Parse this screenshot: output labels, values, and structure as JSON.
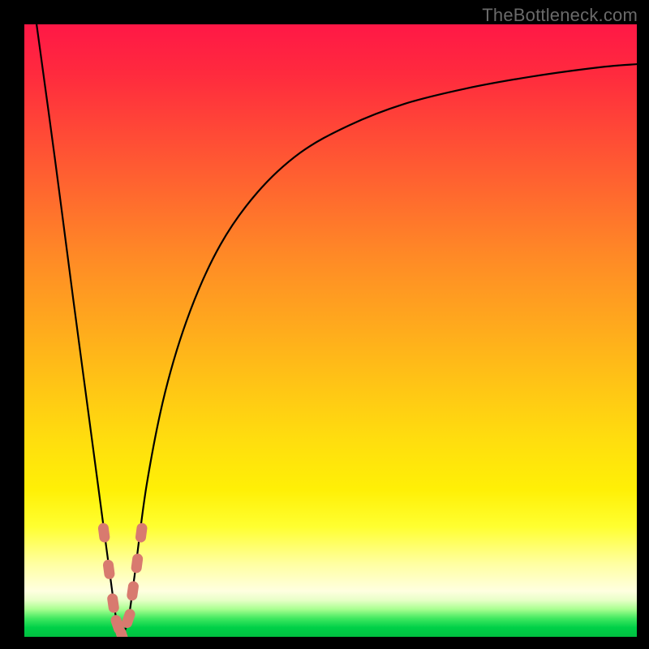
{
  "watermark": "TheBottleneck.com",
  "chart_data": {
    "type": "line",
    "title": "",
    "xlabel": "",
    "ylabel": "",
    "xlim": [
      0,
      1
    ],
    "ylim": [
      0,
      100
    ],
    "series": [
      {
        "name": "bottleneck-curve",
        "x": [
          0.02,
          0.05,
          0.08,
          0.1,
          0.12,
          0.14,
          0.15,
          0.16,
          0.17,
          0.18,
          0.2,
          0.23,
          0.27,
          0.32,
          0.38,
          0.45,
          0.53,
          0.62,
          0.72,
          0.83,
          0.94,
          1.0
        ],
        "y": [
          100.0,
          78.0,
          55.0,
          40.0,
          25.0,
          10.0,
          3.0,
          0.0,
          3.0,
          10.0,
          25.0,
          40.0,
          53.0,
          64.0,
          72.5,
          79.0,
          83.5,
          87.0,
          89.5,
          91.5,
          93.0,
          93.5
        ]
      }
    ],
    "markers": {
      "name": "highlight-points",
      "color": "#d87a6f",
      "x": [
        0.13,
        0.138,
        0.145,
        0.152,
        0.16,
        0.17,
        0.177,
        0.184,
        0.191
      ],
      "y": [
        17.0,
        11.0,
        5.5,
        2.0,
        0.0,
        3.0,
        7.5,
        12.0,
        17.0
      ]
    },
    "gradient_stops": [
      {
        "pos": 0.0,
        "color": "#ff1846"
      },
      {
        "pos": 0.5,
        "color": "#ffc216"
      },
      {
        "pos": 0.9,
        "color": "#ffffc0"
      },
      {
        "pos": 1.0,
        "color": "#00c040"
      }
    ]
  }
}
